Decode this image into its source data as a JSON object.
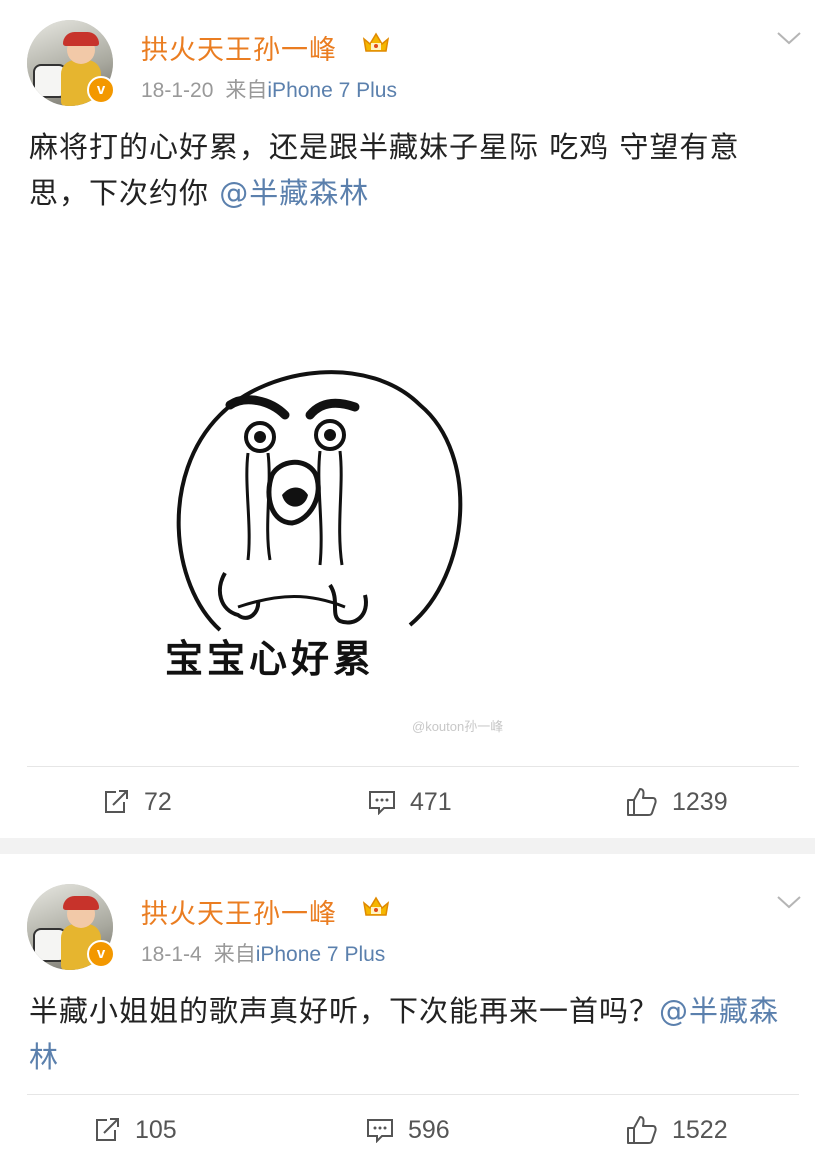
{
  "posts": [
    {
      "username": "拱火天王孙一峰",
      "date": "18-1-20",
      "source_prefix": "来自",
      "source_device": "iPhone 7 Plus",
      "text": "麻将打的心好累，还是跟半藏妹子星际 吃鸡 守望有意思，下次约你 ",
      "mention": "@半藏森林",
      "image": {
        "caption": "宝宝心好累",
        "watermark": "@kouton孙一峰"
      },
      "reposts": "72",
      "comments": "471",
      "likes": "1239"
    },
    {
      "username": "拱火天王孙一峰",
      "date": "18-1-4",
      "source_prefix": "来自",
      "source_device": "iPhone 7 Plus",
      "text": "半藏小姐姐的歌声真好听，下次能再来一首吗？",
      "mention": "@半藏森林",
      "reposts": "105",
      "comments": "596",
      "likes": "1522"
    }
  ],
  "icons": {
    "verified": "v-badge-icon",
    "crown": "crown-icon",
    "dropdown": "chevron-down-icon",
    "repost": "repost-icon",
    "comment": "comment-icon",
    "like": "thumbs-up-icon"
  },
  "colors": {
    "username": "#ea7d21",
    "mention": "#5b80ad",
    "meta": "#999999",
    "badge": "#f39800"
  },
  "badge_letter": "v"
}
